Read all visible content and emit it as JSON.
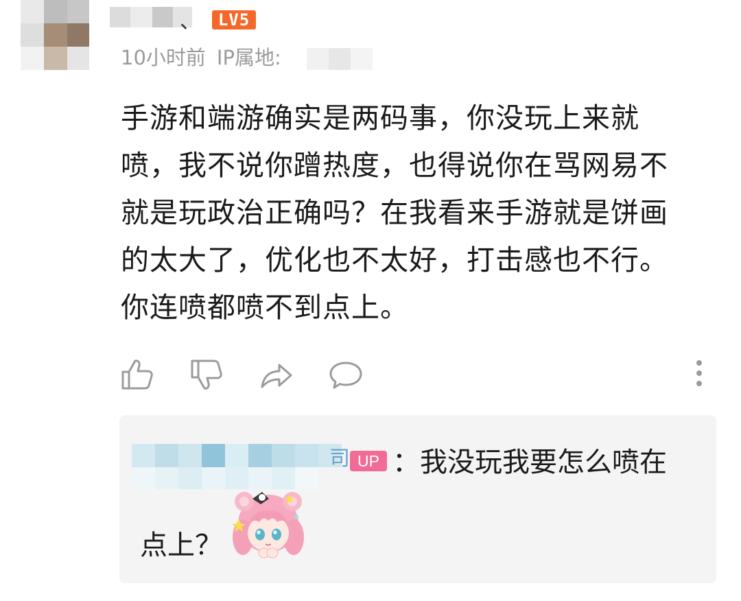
{
  "comment": {
    "author_mark": "、",
    "level_badge": "LV5",
    "time": "10小时前",
    "ip_label": "IP属地:",
    "content_lines": [
      "手游和端游确实是两码事，你没玩上来就",
      "喷，我不说你蹭热度，也得说你在骂网易不",
      "就是玩政治正确吗？在我看来手游就是饼画",
      "的太大了，优化也不太好，打击感也不行。",
      "你连喷都喷不到点上。"
    ]
  },
  "actions": {
    "like_icon": "thumbs-up-icon",
    "dislike_icon": "thumbs-down-icon",
    "share_icon": "share-arrow-icon",
    "reply_icon": "speech-bubble-icon",
    "more_icon": "more-vertical-icon"
  },
  "reply": {
    "name_tail": "司",
    "up_badge": "UP",
    "text_line1": "：我没玩我要怎么喷在",
    "text_line2": "点上？",
    "sticker": "pink-haired-anime-girl-sticker"
  },
  "colors": {
    "level_badge": "#f4692b",
    "up_badge": "#f06c96",
    "meta_text": "#9a9a9a",
    "icon_gray": "#9b9b9b",
    "reply_bg": "#f4f4f4"
  }
}
